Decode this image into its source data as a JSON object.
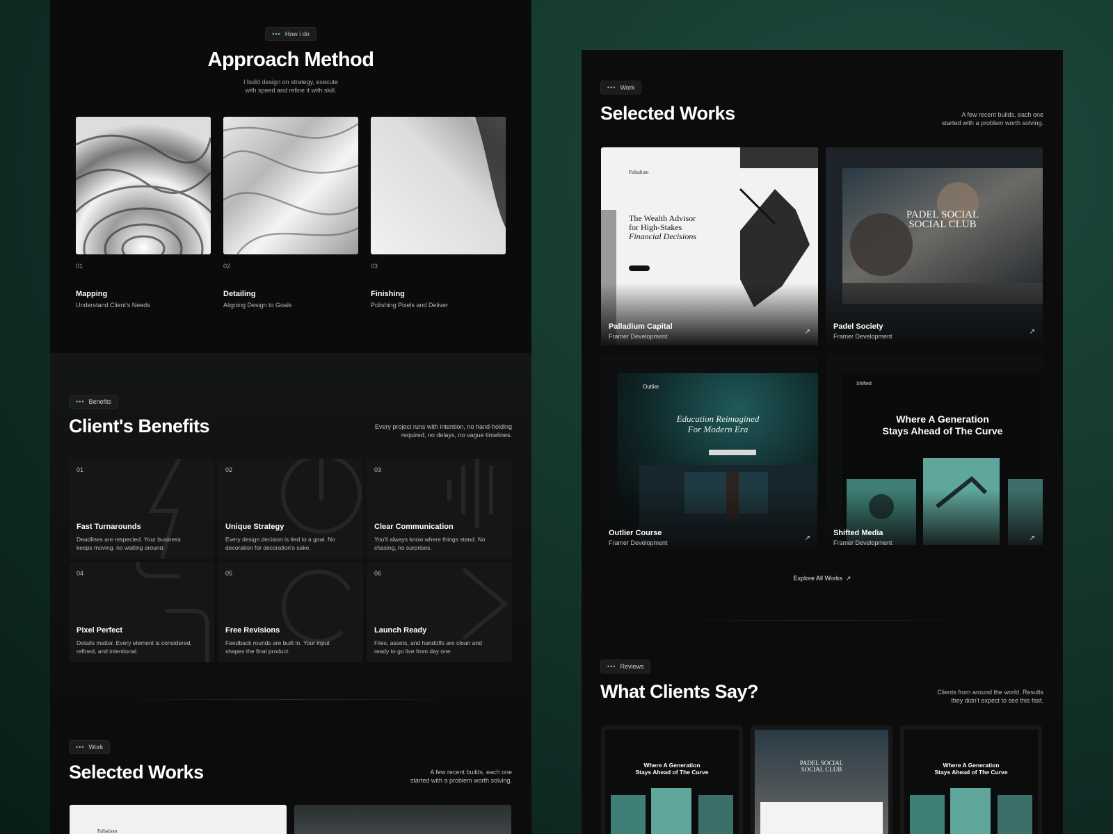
{
  "approach": {
    "tag": "How i do",
    "title": "Approach Method",
    "subtitle_line1": "I build design on strategy, execute",
    "subtitle_line2": "with speed and refine it with skill.",
    "steps": [
      {
        "num": "01",
        "title": "Mapping",
        "desc": "Understand Client's Needs"
      },
      {
        "num": "02",
        "title": "Detailing",
        "desc": "Aligning Design to Goals"
      },
      {
        "num": "03",
        "title": "Finishing",
        "desc": "Polishing Pixels and Deliver"
      }
    ]
  },
  "benefits": {
    "tag": "Benefits",
    "title": "Client's Benefits",
    "subtitle_line1": "Every project runs with intention, no hand-holding",
    "subtitle_line2": "required, no delays, no vague timelines.",
    "cards": [
      {
        "num": "01",
        "title": "Fast Turnarounds",
        "desc": "Deadlines are respected. Your business keeps moving. no waiting around."
      },
      {
        "num": "02",
        "title": "Unique Strategy",
        "desc": "Every design decision is tied to a goal. No decoration for decoration's sake."
      },
      {
        "num": "03",
        "title": "Clear Communication",
        "desc": "You'll always know where things stand. No chasing, no surprises."
      },
      {
        "num": "04",
        "title": "Pixel Perfect",
        "desc": "Details matter. Every element is considered, refined, and intentional."
      },
      {
        "num": "05",
        "title": "Free Revisions",
        "desc": "Feedback rounds are built in. Your input shapes the final product."
      },
      {
        "num": "06",
        "title": "Launch Ready",
        "desc": "Files, assets, and handoffs are clean and ready to go live from day one."
      }
    ]
  },
  "work": {
    "tag": "Work",
    "title": "Selected Works",
    "subtitle_line1": "A few recent builds, each one",
    "subtitle_line2": "started with a problem worth solving.",
    "items": [
      {
        "title": "Palladium Capital",
        "sub": "Framer Development",
        "hero_line1": "The Wealth Advisor",
        "hero_line2": "for High-Stakes",
        "hero_line3": "Financial Decisions",
        "brand": "Palladium"
      },
      {
        "title": "Padel Society",
        "sub": "Framer Development",
        "hero_line1": "PADEL SOCIAL",
        "hero_line2": "SOCIAL CLUB"
      },
      {
        "title": "Outlier Course",
        "sub": "Framer Development",
        "hero_line1": "Education Reimagined",
        "hero_line2": "For Modern Era",
        "brand": "Outlier"
      },
      {
        "title": "Shifted Media",
        "sub": "Framer Development",
        "hero_line1": "Where A Generation",
        "hero_line2": "Stays Ahead of The Curve",
        "brand": "Shifted"
      }
    ],
    "explore": "Explore All Works",
    "arrow": "↗"
  },
  "reviews": {
    "tag": "Reviews",
    "title": "What Clients Say?",
    "subtitle_line1": "Clients from around the world. Results",
    "subtitle_line2": "they didn't expect to see this fast.",
    "thumbs": [
      {
        "line1": "Where A Generation",
        "line2": "Stays Ahead of The Curve"
      },
      {
        "line1": "PADEL SOCIAL",
        "line2": "SOCIAL CLUB"
      },
      {
        "line1": "Where A Generation",
        "line2": "Stays Ahead of The Curve"
      }
    ]
  },
  "colors": {
    "accent": "#7ec8a8",
    "panel": "#0c0c0c",
    "backdrop": "#163a30"
  }
}
